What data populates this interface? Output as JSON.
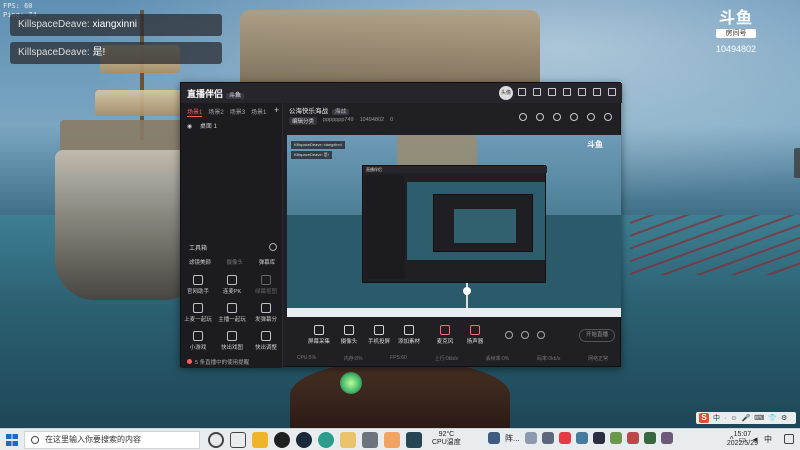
{
  "overlay": {
    "fps": "FPS: 60",
    "ping": "Ping: 74"
  },
  "chat": [
    {
      "user": "KillspaceDeave:",
      "text": "xiangxinni"
    },
    {
      "user": "KillspaceDeave:",
      "text": "是!"
    }
  ],
  "douyu": {
    "logo": "斗鱼",
    "sub": "房间号",
    "room_id": "10494802"
  },
  "app": {
    "name": "直播伴侣",
    "edition": "斗鱼",
    "avatar_text": "头像",
    "scene_tabs": [
      "场景1",
      "场景2",
      "场景3",
      "场景1"
    ],
    "scene_add": "+",
    "scene_item": "桌面 1",
    "toolbox_title": "工具箱",
    "tools_top": [
      "滤镜美颜",
      "摄像头",
      "弹幕库"
    ],
    "tools": [
      {
        "label": "官网助手",
        "dim": false
      },
      {
        "label": "连麦PK",
        "dim": false
      },
      {
        "label": "绿幕抠图",
        "dim": true
      },
      {
        "label": "上麦一起玩",
        "dim": false
      },
      {
        "label": "主播一起玩",
        "dim": false
      },
      {
        "label": "发弹幕分",
        "dim": false
      },
      {
        "label": "小游戏",
        "dim": false
      },
      {
        "label": "快出戏图",
        "dim": false
      },
      {
        "label": "快出调整",
        "dim": false
      }
    ],
    "notice": "5 条直播中的使用提醒",
    "room_title": "公海快乐海战",
    "room_tag": "海战",
    "room_edit": "编辑分类",
    "room_meta": [
      "ppppppp749",
      "10494802",
      "0"
    ],
    "bottom": [
      {
        "label": "屏幕采集"
      },
      {
        "label": "摄像头"
      },
      {
        "label": "手机投屏"
      },
      {
        "label": "添加素材"
      },
      {
        "label": "麦克风",
        "red": true
      },
      {
        "label": "扬声器",
        "red": true
      }
    ],
    "start_label": "开始直播",
    "status": [
      "CPU:5%",
      "内存:8%",
      "FPS:60",
      "上行:0kb/s",
      "丢帧率:0%",
      "码率:0kb/s",
      "网络正常"
    ]
  },
  "preview": {
    "chat1": "KillspaceDeave: xiangxinni",
    "chat2": "KillspaceDeave: 是!",
    "inner_title": "直播伴侣",
    "logo": "斗鱼"
  },
  "ime": {
    "mark": "S",
    "items": [
      "中",
      "·",
      "☺",
      "🎤",
      "⌨",
      "👕",
      "⚙"
    ]
  },
  "taskbar": {
    "search_placeholder": "在这里输入你要搜索的内容",
    "weather_temp": "92°C",
    "weather_label": "CPU温度",
    "tray_label": "阵...",
    "lang": "中",
    "time": "15:07",
    "date": "2022/5/29",
    "colors": {
      "task_view": "#444444",
      "explorer": "#f0b429",
      "qq": "#1f1f1f",
      "steam": "#1b2838",
      "app_green": "#2a9d8f",
      "app_yellow": "#e9c46a",
      "app_gray": "#6c757d",
      "app_orange": "#f4a261"
    }
  }
}
